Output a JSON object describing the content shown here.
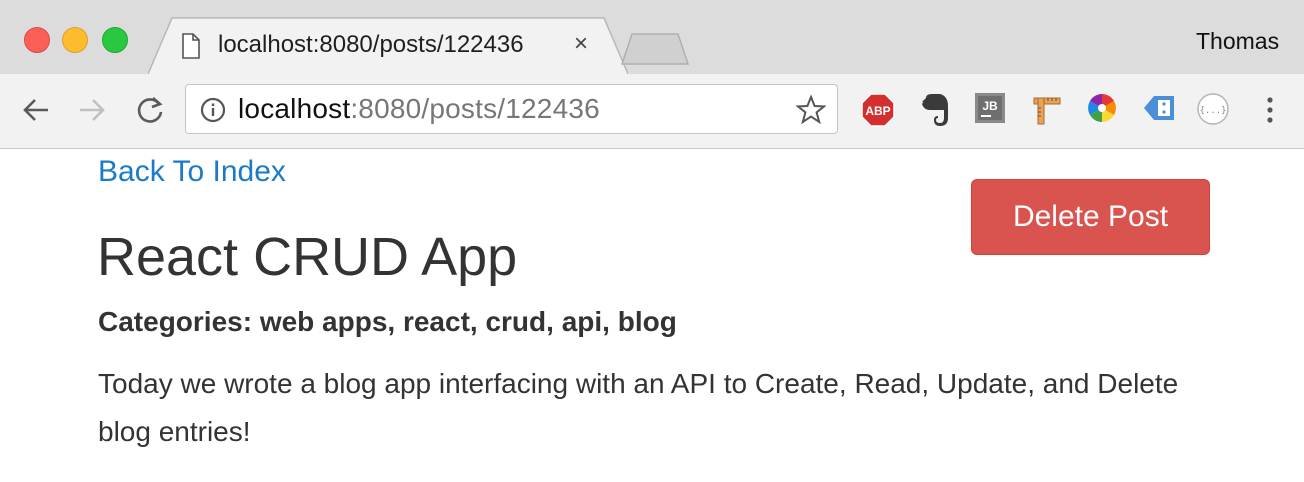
{
  "browser": {
    "tab": {
      "title": "localhost:8080/posts/122436",
      "close": "×"
    },
    "profile_name": "Thomas",
    "address": {
      "host": "localhost",
      "rest": ":8080/posts/122436"
    },
    "extensions": [
      {
        "name": "adblock-plus-icon",
        "label": "ABP"
      },
      {
        "name": "evernote-icon",
        "label": ""
      },
      {
        "name": "jetbrains-icon",
        "label": "JB"
      },
      {
        "name": "ruler-icon",
        "label": ""
      },
      {
        "name": "color-picker-icon",
        "label": ""
      },
      {
        "name": "tag-extension-icon",
        "label": ""
      },
      {
        "name": "json-viewer-icon",
        "label": "{...}"
      }
    ]
  },
  "page": {
    "back_link": "Back To Index",
    "delete_button": "Delete Post",
    "title": "React CRUD App",
    "categories": "Categories: web apps, react, crud, api, blog",
    "content": "Today we wrote a blog app interfacing with an API to Create, Read, Update, and Delete blog entries!"
  },
  "colors": {
    "link": "#1a7bc9",
    "danger": "#d9534f",
    "text": "#333333"
  }
}
